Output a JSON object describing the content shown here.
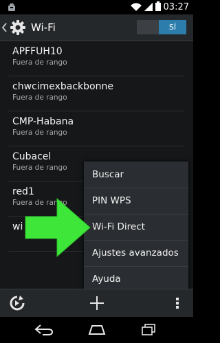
{
  "status_bar": {
    "time": "03:27",
    "icons": [
      "android-notification-icon",
      "wifi-signal-icon",
      "cell-signal-icon",
      "battery-icon"
    ]
  },
  "action_bar": {
    "title": "Wi-Fi",
    "toggle_label": "SÍ",
    "toggle_on": true,
    "accent_color": "#2c7dab"
  },
  "networks": [
    {
      "ssid": "APFFUH10",
      "status": "Fuera de rango"
    },
    {
      "ssid": "chwcimexbackbonne",
      "status": "Fuera de rango"
    },
    {
      "ssid": "CMP-Habana",
      "status": "Fuera de rango"
    },
    {
      "ssid": "Cubacel",
      "status": "Fuera de rango"
    },
    {
      "ssid": "red1",
      "status": "Fuera de rango"
    },
    {
      "ssid": "wi",
      "status": ""
    }
  ],
  "overflow_menu": {
    "items": [
      "Buscar",
      "PIN WPS",
      "Wi-Fi Direct",
      "Ajustes avanzados",
      "Ayuda"
    ]
  },
  "annotation": {
    "icon": "green-arrow-icon",
    "color": "#3ee63a",
    "target": "Wi-Fi Direct"
  },
  "bottom_bar": {
    "icons": [
      "wps-push-icon",
      "add-network-icon",
      "overflow-menu-icon"
    ]
  },
  "nav_bar": {
    "icons": [
      "back-icon",
      "home-icon",
      "recents-icon"
    ]
  }
}
